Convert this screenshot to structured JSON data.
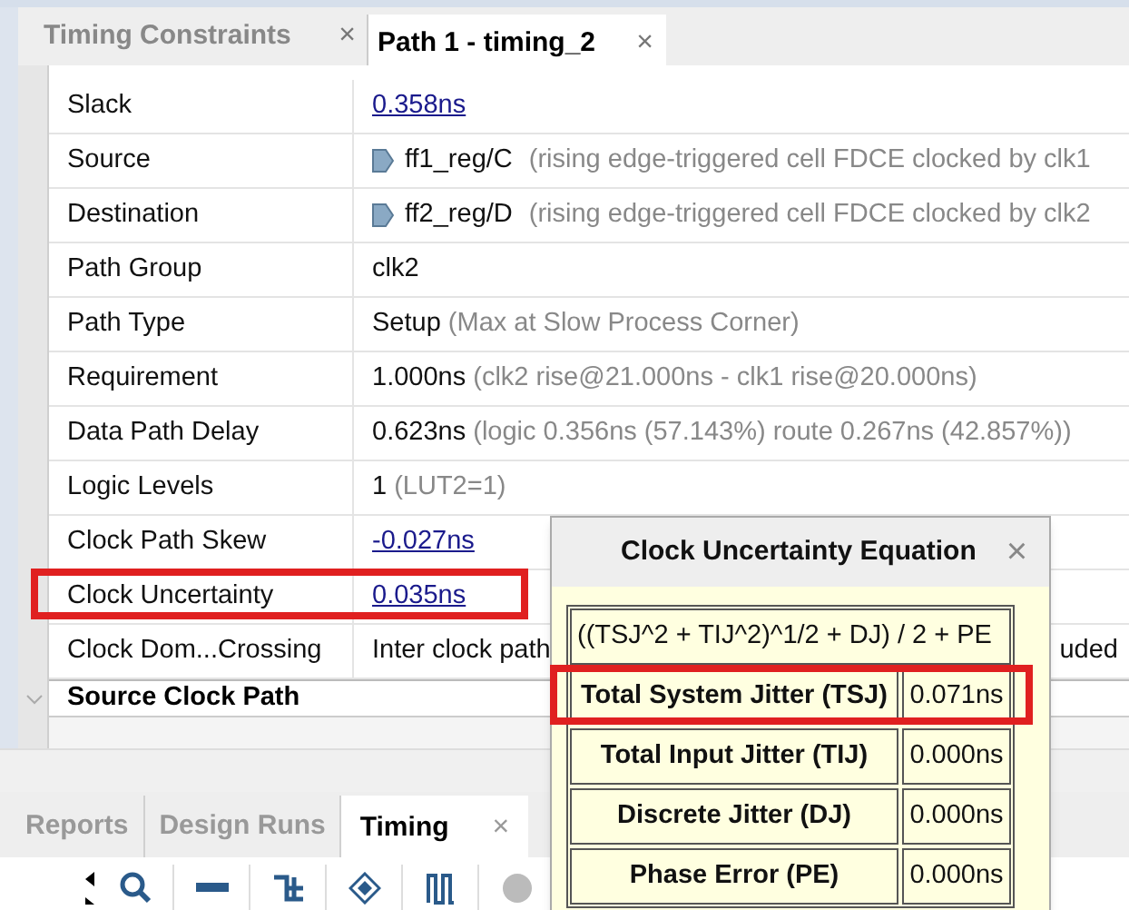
{
  "editor_tabs": [
    {
      "label": "Timing Constraints",
      "selected": false,
      "close": "×"
    },
    {
      "label": "Path 1 - timing_2",
      "selected": true,
      "close": "×"
    }
  ],
  "properties": [
    {
      "label": "Slack",
      "kind": "link",
      "value": "0.358ns",
      "highlighted": false
    },
    {
      "label": "Source",
      "kind": "pin",
      "value": "ff1_reg/C",
      "detail": "(rising edge-triggered cell FDCE clocked by clk1",
      "highlighted": false
    },
    {
      "label": "Destination",
      "kind": "pin",
      "value": "ff2_reg/D",
      "detail": "(rising edge-triggered cell FDCE clocked by clk2",
      "highlighted": false
    },
    {
      "label": "Path Group",
      "kind": "text",
      "value": "clk2",
      "highlighted": false
    },
    {
      "label": "Path Type",
      "kind": "text",
      "value": "Setup",
      "detail": "(Max at Slow Process Corner)",
      "highlighted": false
    },
    {
      "label": "Requirement",
      "kind": "text",
      "value": "1.000ns",
      "detail": "(clk2 rise@21.000ns - clk1 rise@20.000ns)",
      "highlighted": false
    },
    {
      "label": "Data Path Delay",
      "kind": "text",
      "value": "0.623ns",
      "detail": "(logic 0.356ns (57.143%)  route 0.267ns (42.857%))",
      "highlighted": false
    },
    {
      "label": "Logic Levels",
      "kind": "text",
      "value": "1",
      "detail": "(LUT2=1)",
      "highlighted": false
    },
    {
      "label": "Clock Path Skew",
      "kind": "link",
      "value": "-0.027ns",
      "highlighted": false
    },
    {
      "label": "Clock Uncertainty",
      "kind": "link",
      "value": "0.035ns",
      "highlighted": true
    },
    {
      "label": "Clock Dom...Crossing",
      "kind": "text",
      "value": "Inter clock path",
      "tail": "uded",
      "highlighted": false
    }
  ],
  "section": {
    "title": "Source Clock Path",
    "expanded": true
  },
  "bottom_tabs": [
    {
      "label": "Reports",
      "selected": false
    },
    {
      "label": "Design Runs",
      "selected": false
    },
    {
      "label": "Timing",
      "selected": true,
      "close": "×"
    }
  ],
  "popup": {
    "title": "Clock Uncertainty Equation",
    "close": "×",
    "equation": "((TSJ^2 + TIJ^2)^1/2 + DJ) / 2 + PE",
    "rows": [
      {
        "label": "Total System Jitter (TSJ)",
        "value": "0.071ns",
        "highlighted": true
      },
      {
        "label": "Total Input Jitter (TIJ)",
        "value": "0.000ns",
        "highlighted": false
      },
      {
        "label": "Discrete Jitter (DJ)",
        "value": "0.000ns",
        "highlighted": false
      },
      {
        "label": "Phase Error (PE)",
        "value": "0.000ns",
        "highlighted": false
      }
    ]
  }
}
